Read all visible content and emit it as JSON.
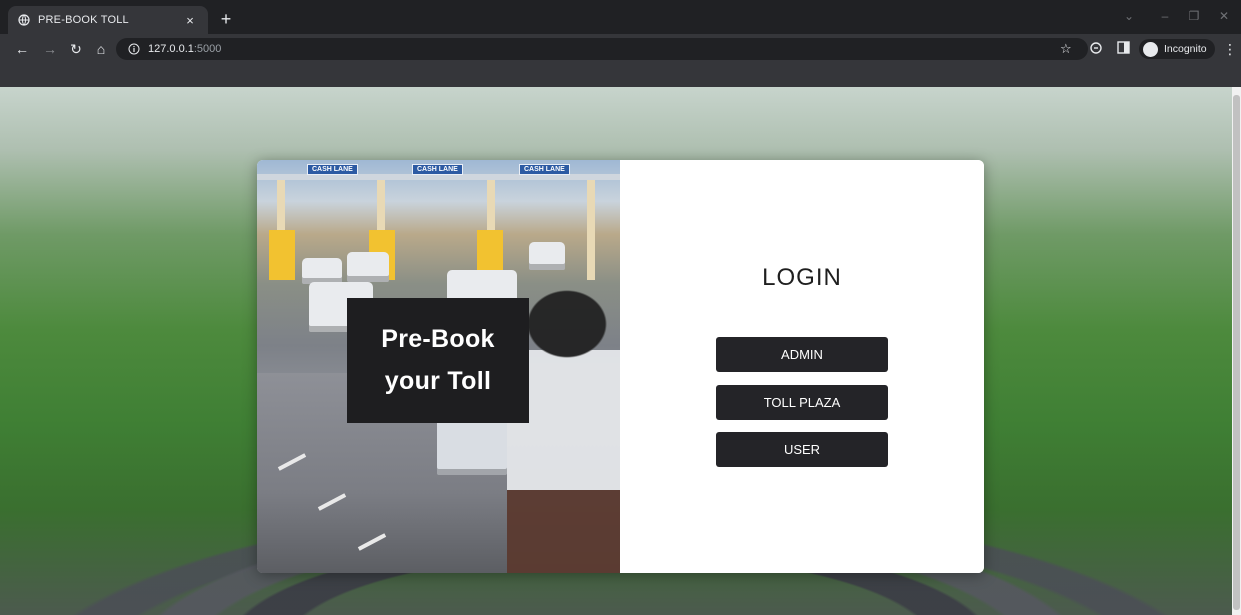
{
  "browser": {
    "tab_title": "PRE-BOOK TOLL",
    "tab_close": "×",
    "new_tab": "+",
    "url_host": "127.0.0.1",
    "url_port": ":5000",
    "incognito_label": "Incognito",
    "icons": [
      "back-arrow-icon",
      "forward-arrow-icon",
      "reload-icon",
      "home-icon",
      "info-icon",
      "star-icon",
      "extension-icon",
      "side-panel-icon",
      "incognito-icon",
      "menu-icon"
    ]
  },
  "hero": {
    "lane_signs": [
      "CASH LANE",
      "CASH LANE",
      "CASH LANE"
    ],
    "promo_line1": "Pre-Book",
    "promo_line2": "your Toll"
  },
  "login": {
    "title": "LOGIN",
    "buttons": [
      {
        "label": "ADMIN"
      },
      {
        "label": "TOLL PLAZA"
      },
      {
        "label": "USER"
      }
    ]
  },
  "colors": {
    "chrome_dark": "#202124",
    "chrome_toolbar": "#35363a",
    "button_bg": "#242428",
    "promo_bg": "#1e1e20",
    "card_bg": "#ffffff"
  }
}
